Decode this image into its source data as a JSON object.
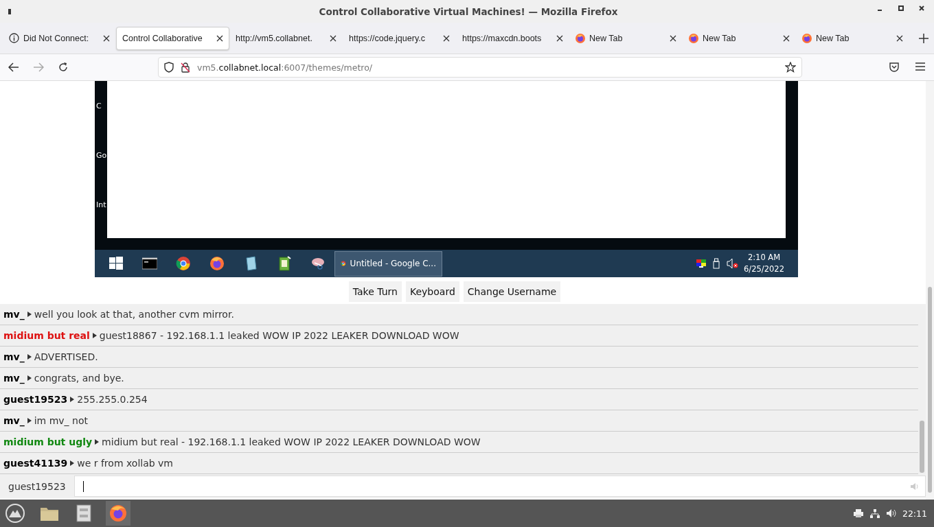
{
  "window": {
    "title": "Control Collaborative Virtual Machines! — Mozilla Firefox"
  },
  "tabs": [
    {
      "label": "Did Not Connect:",
      "kind": "error",
      "selected": false
    },
    {
      "label": "Control Collaborative",
      "kind": "site",
      "selected": true
    },
    {
      "label": "http://vm5.collabnet.",
      "kind": "site",
      "selected": false
    },
    {
      "label": "https://code.jquery.c",
      "kind": "site",
      "selected": false
    },
    {
      "label": "https://maxcdn.boots",
      "kind": "site",
      "selected": false
    },
    {
      "label": "New Tab",
      "kind": "newtab",
      "selected": false
    },
    {
      "label": "New Tab",
      "kind": "newtab",
      "selected": false
    },
    {
      "label": "New Tab",
      "kind": "newtab",
      "selected": false
    }
  ],
  "address_bar": {
    "host_start": "vm5.",
    "host": "collabnet.local",
    "rest": ":6007/themes/metro/"
  },
  "vm_screen": {
    "desktop_labels": [
      "C",
      "Go",
      "Int"
    ],
    "taskbar": {
      "window_button": "Untitled - Google C...",
      "time": "2:10 AM",
      "date": "6/25/2022"
    }
  },
  "vm_buttons": [
    "Take Turn",
    "Keyboard",
    "Change Username"
  ],
  "chat": {
    "messages": [
      {
        "user": "mv_",
        "color": "#000000",
        "text": "well you look at that, another cvm mirror."
      },
      {
        "user": "midium but real",
        "color": "#dd1111",
        "text": "guest18867 - 192.168.1.1 leaked WOW IP 2022 LEAKER DOWNLOAD WOW"
      },
      {
        "user": "mv_",
        "color": "#000000",
        "text": "ADVERTISED."
      },
      {
        "user": "mv_",
        "color": "#000000",
        "text": "congrats, and bye."
      },
      {
        "user": "guest19523",
        "color": "#000000",
        "text": "255.255.0.254"
      },
      {
        "user": "mv_",
        "color": "#000000",
        "text": "im mv_ not"
      },
      {
        "user": "midium but ugly",
        "color": "#118811",
        "text": "midium but real - 192.168.1.1 leaked WOW IP 2022 LEAKER DOWNLOAD WOW"
      },
      {
        "user": "guest41139",
        "color": "#000000",
        "text": "we r from xollab vm"
      }
    ],
    "username": "guest19523"
  },
  "os_taskbar": {
    "time": "22:11"
  }
}
